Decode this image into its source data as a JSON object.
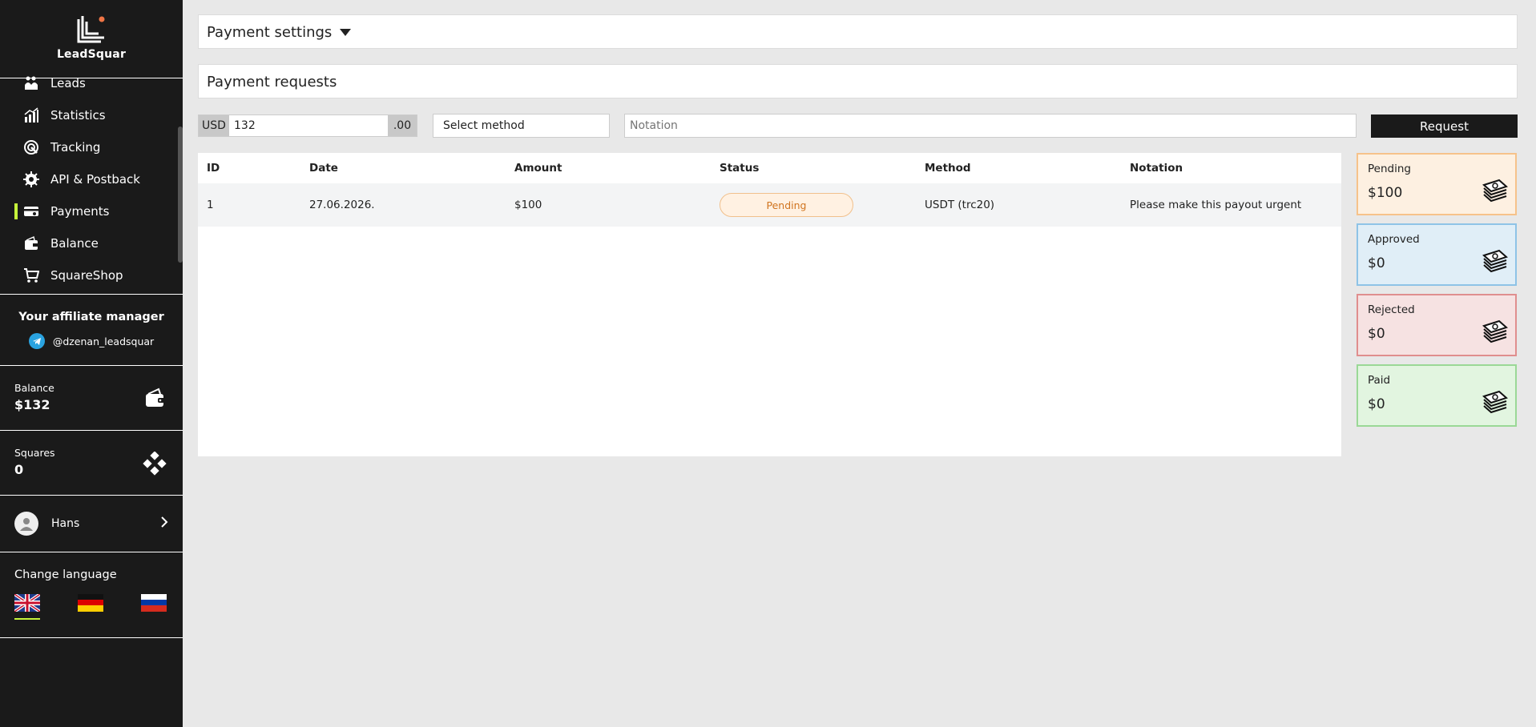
{
  "brand": {
    "name": "LeadSquar"
  },
  "sidebar": {
    "nav": [
      {
        "label": "Leads",
        "icon": "leads-icon"
      },
      {
        "label": "Statistics",
        "icon": "statistics-icon"
      },
      {
        "label": "Tracking",
        "icon": "tracking-icon"
      },
      {
        "label": "API & Postback",
        "icon": "api-icon"
      },
      {
        "label": "Payments",
        "icon": "payments-icon",
        "active": true
      },
      {
        "label": "Balance",
        "icon": "balance-icon"
      },
      {
        "label": "SquareShop",
        "icon": "cart-icon"
      }
    ],
    "manager": {
      "title": "Your affiliate manager",
      "handle": "@dzenan_leadsquar"
    },
    "balance": {
      "label": "Balance",
      "value": "$132"
    },
    "squares": {
      "label": "Squares",
      "value": "0"
    },
    "user": {
      "name": "Hans"
    },
    "language": {
      "title": "Change language",
      "options": [
        "English",
        "German",
        "Russian"
      ],
      "selected": "English"
    }
  },
  "main": {
    "settings_title": "Payment settings",
    "requests_title": "Payment requests",
    "form": {
      "currency": "USD",
      "amount": "132",
      "decimals": ".00",
      "method_placeholder": "Select method",
      "notation_placeholder": "Notation",
      "request_label": "Request"
    },
    "table": {
      "headers": [
        "ID",
        "Date",
        "Amount",
        "Status",
        "Method",
        "Notation"
      ],
      "rows": [
        {
          "id": "1",
          "date": "27.06.2026.",
          "amount": "$100",
          "status": "Pending",
          "method": "USDT (trc20)",
          "notation": "Please make this payout urgent"
        }
      ]
    },
    "stats": [
      {
        "label": "Pending",
        "value": "$100",
        "bg": "#fdf0e1",
        "border": "#f6c28a"
      },
      {
        "label": "Approved",
        "value": "$0",
        "bg": "#e0eef7",
        "border": "#8ec3e6"
      },
      {
        "label": "Rejected",
        "value": "$0",
        "bg": "#f6e2e2",
        "border": "#e08e8e"
      },
      {
        "label": "Paid",
        "value": "$0",
        "bg": "#e2f5e0",
        "border": "#9ad896"
      }
    ]
  },
  "colors": {
    "sidebar": "#1a1a1a",
    "accent": "#c6f43a",
    "pending_text": "#d0741f"
  }
}
